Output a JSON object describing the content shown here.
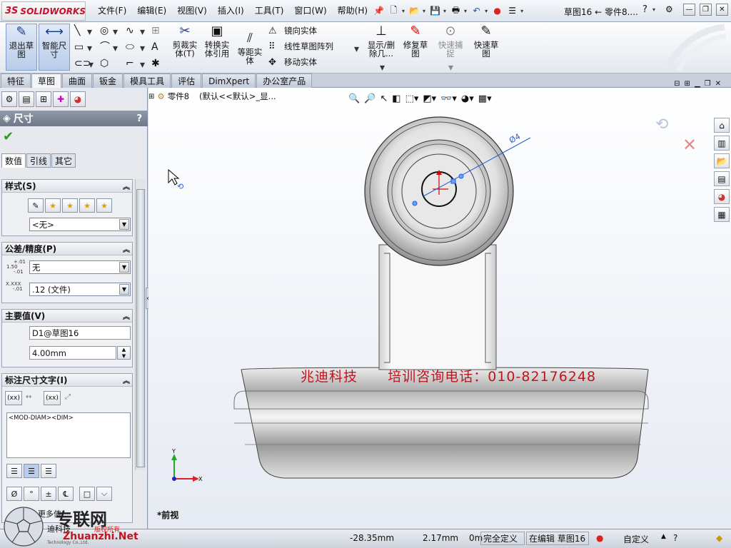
{
  "app": {
    "brand_ds": "3S",
    "brand": "SOLIDWORKS"
  },
  "menu": [
    "文件(F)",
    "编辑(E)",
    "视图(V)",
    "插入(I)",
    "工具(T)",
    "窗口(W)",
    "帮助(H)"
  ],
  "document_title": "草图16 ← 零件8....",
  "help_glyph": "?",
  "command_manager": {
    "exit_sketch": "退出草\n图",
    "smart_dimension": "智能尺\n寸",
    "trim": "剪裁实\n体(T)",
    "convert": "转换实\n体引用",
    "offset": "等距实\n体",
    "mirror": "镜向实体",
    "linear_pattern": "线性草图阵列",
    "move": "移动实体",
    "display_delete": "显示/删\n除几...",
    "repair": "修复草\n图",
    "quick_snap": "快速捕\n捉",
    "rapid_sketch": "快速草\n图"
  },
  "tabs": [
    {
      "label": "特征",
      "active": false
    },
    {
      "label": "草图",
      "active": true
    },
    {
      "label": "曲面",
      "active": false
    },
    {
      "label": "钣金",
      "active": false
    },
    {
      "label": "模具工具",
      "active": false
    },
    {
      "label": "评估",
      "active": false
    },
    {
      "label": "DimXpert",
      "active": false
    },
    {
      "label": "办公室产品",
      "active": false
    }
  ],
  "property_manager": {
    "title": "尺寸",
    "help": "?",
    "subtabs": [
      "数值",
      "引线",
      "其它"
    ],
    "style": {
      "header": "样式(S)",
      "selected": "<无>"
    },
    "tolerance": {
      "header": "公差/精度(P)",
      "tolerance_icon_top": "1.50",
      "tolerance_icon_sup": "+.01",
      "tolerance_icon_sub": "-.01",
      "tolerance_value": "无",
      "precision_icon": "X.XXX",
      "precision_value": ".12 (文件)"
    },
    "primary": {
      "header": "主要值(V)",
      "name": "D1@草图16",
      "value": "4.00mm"
    },
    "dim_text": {
      "header": "标注尺寸文字(I)",
      "btn_xx": "(xx)",
      "text": "<MOD-DIAM><DIM>",
      "more_label": "更多值..."
    }
  },
  "graphics": {
    "tree_label": "零件8",
    "tree_config": "(默认<<默认>_显...",
    "view_name": "*前视",
    "dimension_label": "Ø4",
    "axis_x": "X",
    "axis_y": "Y",
    "watermark": "兆迪科技      培训咨询电话：010-82176248"
  },
  "status": {
    "x": "-28.35mm",
    "y": "2.17mm",
    "z": "0m",
    "constraint": "完全定义",
    "editing": "在编辑 草图16",
    "units": "自定义"
  },
  "site_logo": {
    "big": "专联网",
    "url": "Zhuanzhi.Net",
    "company": "迪科技",
    "tagline": "Technology Co.,Ltd.",
    "red_tag": "版权所有"
  },
  "colors": {
    "accent_red": "#c8102e",
    "watermark_red": "#c0141f",
    "ok_green": "#2a9a1f",
    "sketch_blue": "#1f5fd6"
  }
}
